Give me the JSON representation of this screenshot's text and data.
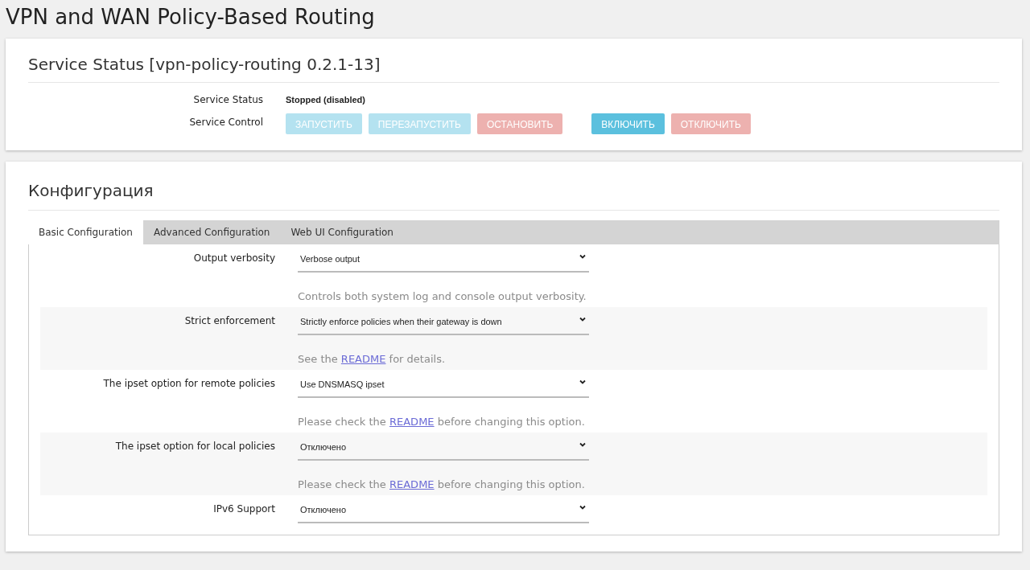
{
  "page_title": "VPN and WAN Policy-Based Routing",
  "service": {
    "title": "Service Status [vpn-policy-routing 0.2.1-13]",
    "status_label": "Service Status",
    "status_value": "Stopped (disabled)",
    "control_label": "Service Control",
    "buttons": [
      {
        "label": "ЗАПУСТИТЬ",
        "kind": "info",
        "disabled": true
      },
      {
        "label": "ПЕРЕЗАПУСТИТЬ",
        "kind": "info",
        "disabled": true
      },
      {
        "label": "ОСТАНОВИТЬ",
        "kind": "danger",
        "disabled": true
      }
    ],
    "enable_buttons": [
      {
        "label": "ВКЛЮЧИТЬ",
        "kind": "info",
        "disabled": false
      },
      {
        "label": "ОТКЛЮЧИТЬ",
        "kind": "danger",
        "disabled": true
      }
    ]
  },
  "config": {
    "title": "Конфигурация",
    "tabs": [
      {
        "label": "Basic Configuration",
        "selected": true
      },
      {
        "label": "Advanced Configuration",
        "selected": false
      },
      {
        "label": "Web UI Configuration",
        "selected": false
      }
    ],
    "options": [
      {
        "label": "Output verbosity",
        "value": "Verbose output",
        "description": {
          "before": "Controls both system log and console output verbosity."
        }
      },
      {
        "label": "Strict enforcement",
        "value": "Strictly enforce policies when their gateway is down",
        "description": {
          "before": "See the ",
          "link": "README",
          "after": " for details."
        }
      },
      {
        "label": "The ipset option for remote policies",
        "value": "Use DNSMASQ ipset",
        "description": {
          "before": "Please check the ",
          "link": "README",
          "after": " before changing this option."
        }
      },
      {
        "label": "The ipset option for local policies",
        "value": "Отключено",
        "description": {
          "before": "Please check the ",
          "link": "README",
          "after": " before changing this option."
        }
      },
      {
        "label": "IPv6 Support",
        "value": "Отключено"
      }
    ]
  }
}
